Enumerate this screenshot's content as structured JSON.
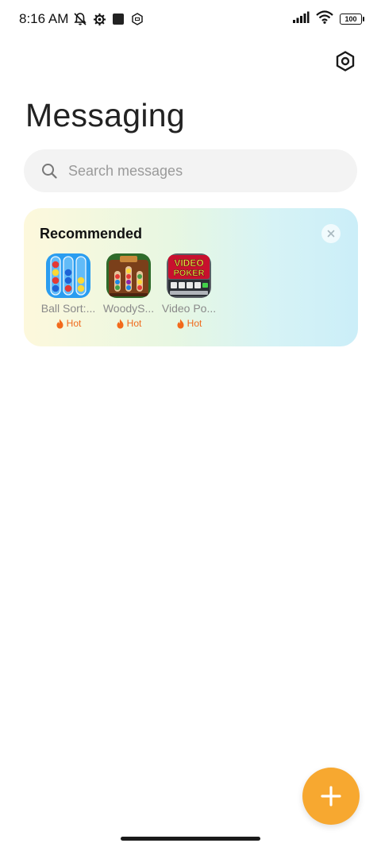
{
  "status_bar": {
    "time": "8:16 AM",
    "battery": "100",
    "icons": [
      "mute-bell-icon",
      "gear-small-icon",
      "square-icon",
      "hexagon-icon",
      "signal-icon",
      "wifi-icon",
      "battery-icon"
    ]
  },
  "header": {
    "title": "Messaging",
    "settings_icon": "settings-hexagon-icon"
  },
  "search": {
    "placeholder": "Search messages",
    "icon": "search-icon"
  },
  "recommended": {
    "title": "Recommended",
    "close_icon": "close-icon",
    "apps": [
      {
        "name": "Ball Sort:...",
        "badge": "Hot",
        "icon": "ball-sort-app-icon"
      },
      {
        "name": "WoodyS...",
        "badge": "Hot",
        "icon": "woody-sort-app-icon"
      },
      {
        "name": "Video Po...",
        "badge": "Hot",
        "icon": "video-poker-app-icon",
        "icon_text_1": "VIDEO",
        "icon_text_2": "POKER"
      }
    ]
  },
  "fab": {
    "icon": "plus-icon"
  },
  "colors": {
    "accent": "#f7a830",
    "hot": "#f06a1c",
    "search_bg": "#f3f3f3"
  }
}
